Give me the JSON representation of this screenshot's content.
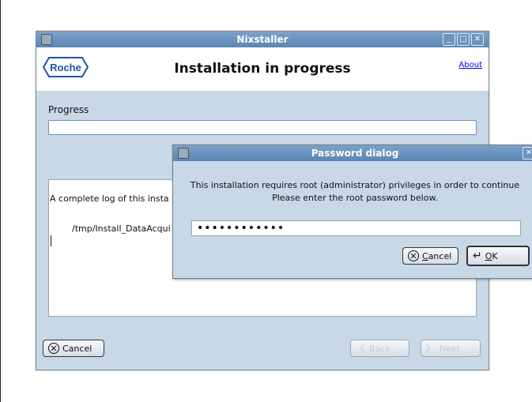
{
  "window": {
    "title": "Nixstaller",
    "header_title": "Installation in progress",
    "logo_text": "Roche",
    "about_link": "About",
    "progress_label": "Progress",
    "progress_fraction": 0,
    "log_line1": "A complete log of this insta",
    "log_line2": "/tmp/Install_DataAcqui",
    "cancel_label": "Cancel",
    "back_label": "Back",
    "next_label": "Next"
  },
  "dialog": {
    "title": "Password dialog",
    "message_line1": "This installation requires root (administrator) privileges in order to continue",
    "message_line2": "Please enter the root password below.",
    "password_value": "••••••••••••",
    "cancel_prefix": "",
    "cancel_mnemonic": "C",
    "cancel_rest": "ancel",
    "ok_mnemonic": "O",
    "ok_rest": "K"
  }
}
